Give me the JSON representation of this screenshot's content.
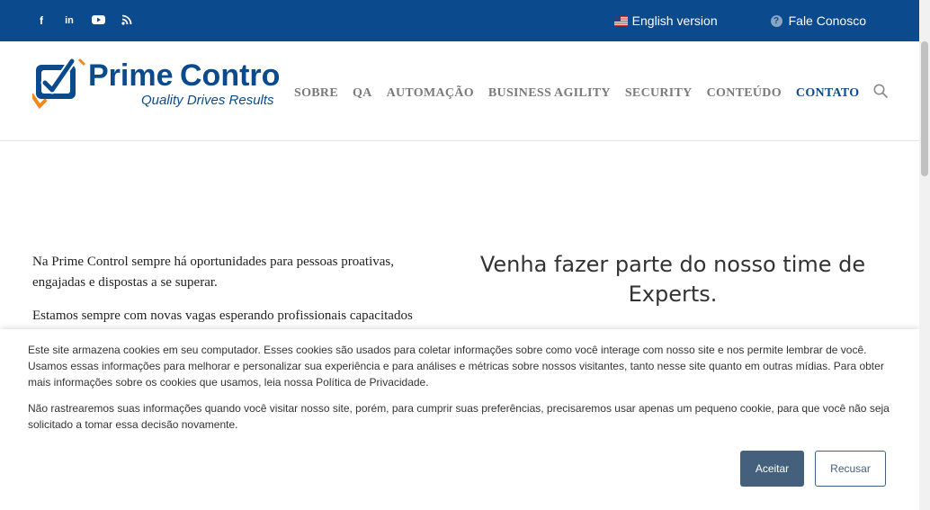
{
  "topbar": {
    "social": [
      {
        "icon": "facebook-icon",
        "glyph": "f"
      },
      {
        "icon": "linkedin-icon",
        "glyph": "in"
      },
      {
        "icon": "youtube-icon",
        "glyph": ""
      },
      {
        "icon": "rss-icon",
        "glyph": ""
      }
    ],
    "english_label": "English version",
    "contact_label": "Fale Conosco",
    "help_glyph": "?"
  },
  "header": {
    "logo_brand_1": "Prime",
    "logo_brand_2": "Control",
    "logo_tagline": "Quality Drives Results",
    "nav": [
      "SOBRE",
      "QA",
      "AUTOMAÇÃO",
      "BUSINESS AGILITY",
      "SECURITY",
      "CONTEÚDO",
      "CONTATO"
    ],
    "active_nav": "CONTATO"
  },
  "main": {
    "paragraph1": "Na Prime Control sempre há oportunidades para pessoas proativas, engajadas e dispostas a se superar.",
    "paragraph2": "Estamos sempre com novas vagas esperando profissionais capacitados",
    "headline": "Venha fazer parte do nosso time de Experts."
  },
  "cookie_banner": {
    "text1": "Este site armazena cookies em seu computador. Esses cookies são usados para coletar informações sobre como você interage com nosso site e nos permite lembrar de você. Usamos essas informações para melhorar e personalizar sua experiência e para análises e métricas sobre nossos visitantes, tanto nesse site quanto em outras mídias. Para obter mais informações sobre os cookies que usamos, leia nossa Política de Privacidade.",
    "text2": "Não rastrearemos suas informações quando você visitar nosso site, porém, para cumprir suas preferências, precisaremos usar apenas um pequeno cookie, para que você não seja solicitado a tomar essa decisão novamente.",
    "accept_label": "Aceitar",
    "decline_label": "Recusar"
  },
  "colors": {
    "brand_blue": "#0b4a8c",
    "logo_orange": "#f08a1c",
    "button_dark": "#45607c"
  }
}
